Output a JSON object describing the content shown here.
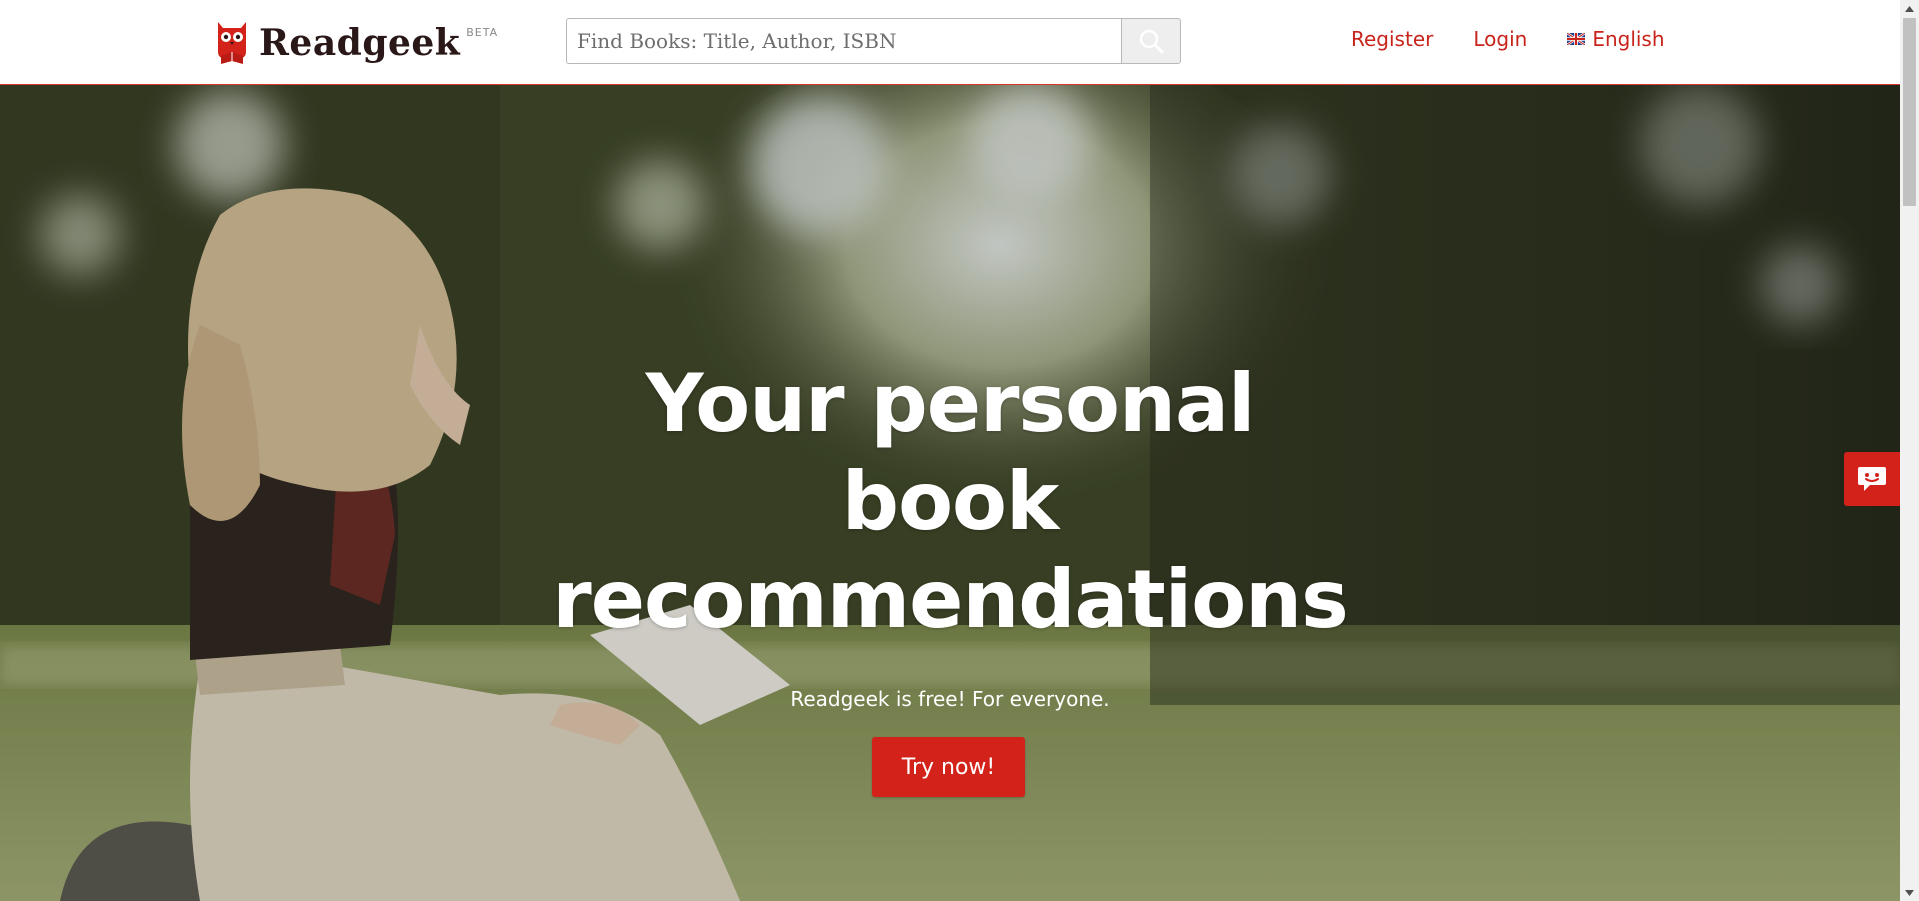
{
  "header": {
    "logo_text": "Readgeek",
    "logo_badge": "BETA",
    "search": {
      "placeholder": "Find Books: Title, Author, ISBN",
      "value": ""
    },
    "nav": {
      "register": "Register",
      "login": "Login",
      "language": "English"
    }
  },
  "hero": {
    "title_lines": [
      "Your personal",
      "book",
      "recommendations"
    ],
    "subtitle": "Readgeek is free! For everyone.",
    "cta_label": "Try now!"
  },
  "icons": {
    "logo": "owl-logo-icon",
    "search": "search-icon",
    "language_flag": "uk-flag-icon",
    "feedback": "chat-bubble-icon"
  },
  "colors": {
    "accent": "#d32219",
    "nav_link": "#c8241b",
    "logo_text": "#2a1818",
    "hero_text": "#ffffff"
  }
}
